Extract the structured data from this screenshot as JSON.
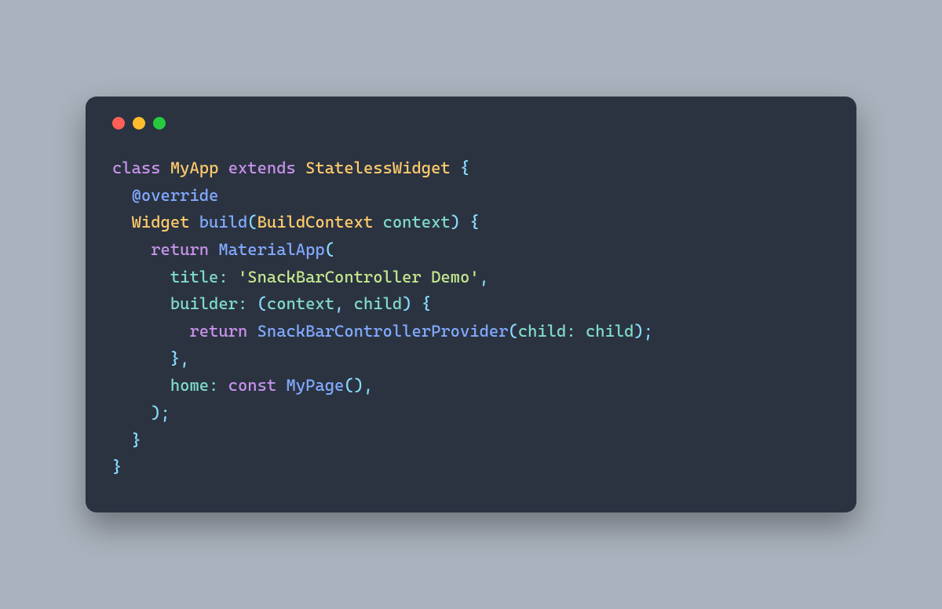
{
  "window": {
    "traffic_lights": {
      "red": "#ff5f56",
      "yellow": "#ffbd2e",
      "green": "#27c93f"
    }
  },
  "code": {
    "kw_class": "class",
    "sp": " ",
    "cls_MyApp": "MyApp",
    "kw_extends": "extends",
    "cls_StatelessWidget": "StatelessWidget",
    "brace_open": "{",
    "brace_close": "}",
    "indent1": "  ",
    "indent2": "    ",
    "indent3": "      ",
    "indent4": "        ",
    "anno_override": "@override",
    "type_Widget": "Widget",
    "fn_build": "build",
    "paren_open": "(",
    "paren_close": ")",
    "type_BuildContext": "BuildContext",
    "id_context": "context",
    "kw_return": "return",
    "fn_MaterialApp": "MaterialApp",
    "label_title": "title:",
    "str_title_val": "'SnackBarController Demo'",
    "comma": ",",
    "label_builder": "builder:",
    "id_child": "child",
    "fn_SnackBarControllerProvider": "SnackBarControllerProvider",
    "label_child": "child:",
    "semicolon": ";",
    "label_home": "home:",
    "kw_const": "const",
    "fn_MyPage": "MyPage"
  }
}
